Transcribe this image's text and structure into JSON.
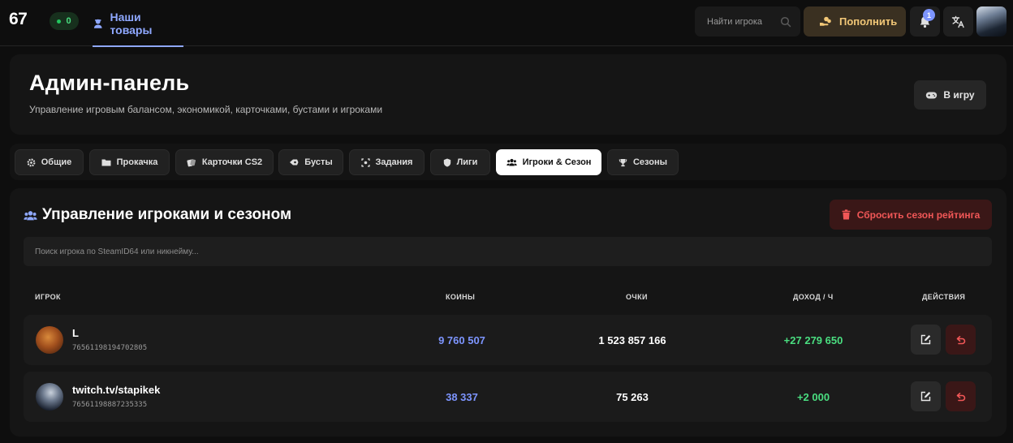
{
  "topbar": {
    "logo": "67",
    "online_count": "0",
    "nav_tab": "Наши товары",
    "search_placeholder": "Найти игрока",
    "topup_label": "Пополнить",
    "notification_count": "1"
  },
  "header": {
    "title": "Админ-панель",
    "subtitle": "Управление игровым балансом, экономикой, карточками, бустами и игроками",
    "play_button": "В игру"
  },
  "tabs": [
    {
      "label": "Общие",
      "icon": "gear-icon"
    },
    {
      "label": "Прокачка",
      "icon": "folder-icon"
    },
    {
      "label": "Карточки CS2",
      "icon": "cards-icon"
    },
    {
      "label": "Бусты",
      "icon": "rocket-icon"
    },
    {
      "label": "Задания",
      "icon": "tasks-icon"
    },
    {
      "label": "Лиги",
      "icon": "shield-icon"
    },
    {
      "label": "Игроки & Сезон",
      "icon": "users-icon",
      "active": true
    },
    {
      "label": "Сезоны",
      "icon": "trophy-icon"
    }
  ],
  "section": {
    "title": "Управление игроками и сезоном",
    "reset_button": "Сбросить сезон рейтинга",
    "search_placeholder": "Поиск игрока по SteamID64 или никнейму..."
  },
  "table": {
    "columns": [
      "ИГРОК",
      "КОИНЫ",
      "ОЧКИ",
      "ДОХОД / Ч",
      "ДЕЙСТВИЯ"
    ],
    "rows": [
      {
        "name": "L",
        "steam_id": "76561198194702805",
        "coins": "9 760 507",
        "points": "1 523 857 166",
        "income": "+27 279 650"
      },
      {
        "name": "twitch.tv/stapikek",
        "steam_id": "76561198887235335",
        "coins": "38 337",
        "points": "75 263",
        "income": "+2 000"
      }
    ]
  },
  "colors": {
    "accent": "#8fa8ff",
    "coins": "#7d95ff",
    "income": "#4ade80",
    "danger": "#f15757",
    "gold": "#f2c777"
  }
}
